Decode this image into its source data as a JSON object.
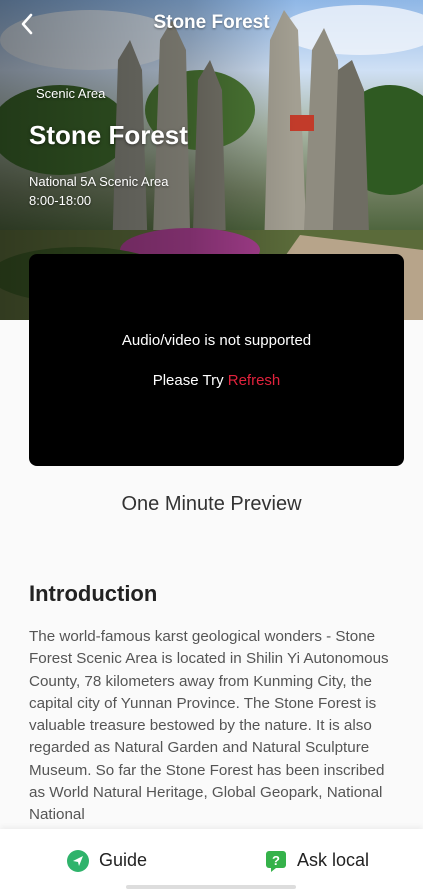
{
  "header": {
    "title": "Stone Forest"
  },
  "hero": {
    "category": "Scenic Area",
    "title": "Stone Forest",
    "rating": "National 5A Scenic Area",
    "hours": "8:00-18:00"
  },
  "video": {
    "message": "Audio/video is not supported",
    "retry_prefix": "Please Try ",
    "retry_link": "Refresh"
  },
  "preview": {
    "label": "One Minute Preview"
  },
  "intro": {
    "heading": "Introduction",
    "text": "The world-famous karst geological wonders - Stone Forest Scenic Area is located in Shilin Yi Autonomous County, 78 kilometers away from Kunming City, the capital city of Yunnan Province. The Stone Forest is valuable treasure bestowed by the nature. It is also regarded as Natural Garden and Natural Sculpture Museum. So far the Stone Forest has been inscribed as World Natural Heritage, Global Geopark, National National"
  },
  "bottom_bar": {
    "guide_label": "Guide",
    "ask_label": "Ask local"
  },
  "colors": {
    "accent_link": "#e0223c",
    "guide_icon": "#2fb36b",
    "ask_icon": "#35b24a"
  },
  "icons": {
    "back": "chevron-left-icon",
    "guide": "navigation-arrow-icon",
    "ask": "question-bubble-icon"
  }
}
